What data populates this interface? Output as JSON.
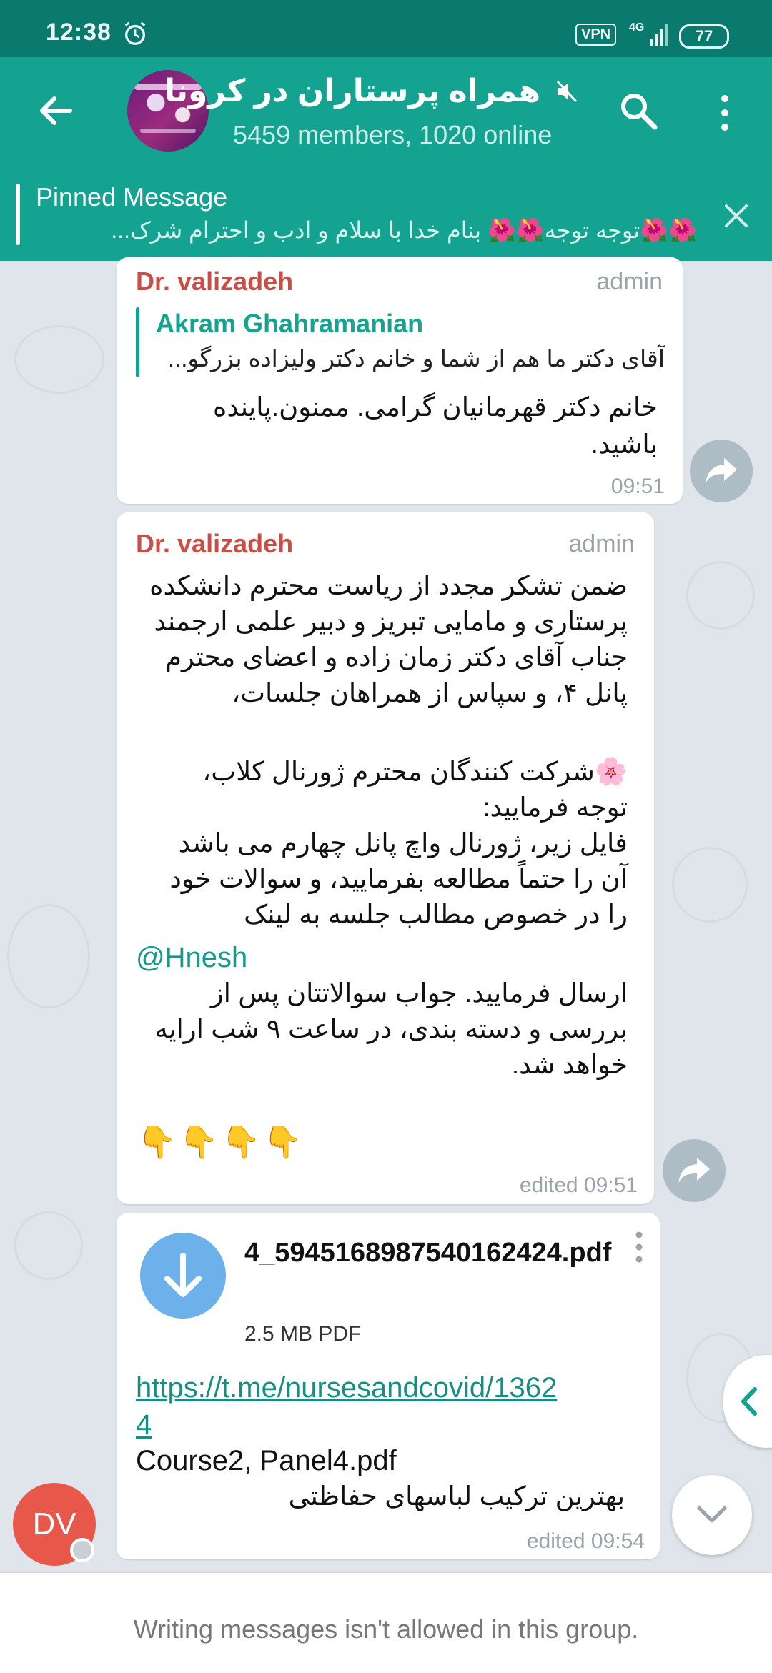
{
  "status_bar": {
    "time": "12:38",
    "vpn": "VPN",
    "network": "4G",
    "battery": "77"
  },
  "header": {
    "title": "همراه پرستاران در کرونا",
    "subtitle": "5459 members, 1020 online",
    "icons": [
      "back-arrow-icon",
      "mute-icon",
      "search-icon",
      "more-vertical-icon"
    ]
  },
  "pinned": {
    "title": "Pinned Message",
    "text": "🌺🌺توجه توجه🌺🌺  بنام خدا  با سلام و ادب و احترام  شرک..."
  },
  "messages": [
    {
      "sender": "Dr. valizadeh",
      "role": "admin",
      "reply_name": "Akram Ghahramanian",
      "reply_text": "آقای دکتر ما هم از شما و خانم دکتر ولیزاده بزرگو...",
      "lines": [
        "خانم دکتر قهرمانیان گرامی. ممنون.پاینده",
        "باشید."
      ],
      "time": "09:51"
    },
    {
      "sender": "Dr. valizadeh",
      "role": "admin",
      "lines_1": [
        "ضمن تشکر مجدد از ریاست محترم دانشکده",
        "پرستاری و مامایی تبریز و دبیر علمی ارجمند",
        "جناب آقای دکتر زمان زاده و اعضای محترم",
        "پانل ۴، و سپاس از همراهان جلسات،"
      ],
      "lines_2": [
        "🌸شرکت کنندگان محترم ژورنال کلاب،",
        "توجه فرمایید:",
        "فایل زیر، ژورنال واچ پانل چهارم می باشد",
        "آن را حتماً مطالعه بفرمایید، و سوالات خود",
        "را در خصوص مطالب جلسه به لینک"
      ],
      "mention": "@Hnesh",
      "lines_3": [
        "ارسال فرمایید. جواب سوالاتتان پس از",
        "بررسی و دسته بندی، در ساعت ۹ شب ارایه",
        "خواهد شد."
      ],
      "emoji_row": "👇👇👇👇",
      "time": "edited 09:51"
    },
    {
      "file_name": "4_5945168987540162424.pdf",
      "file_size": "2.5 MB PDF",
      "link": "https://t.me/nursesandcovid/13624",
      "caption_en": "Course2, Panel4.pdf",
      "caption_fa": "بهترین ترکیب لباسهای حفاظتی",
      "time": "edited 09:54"
    }
  ],
  "avatar_initials": "DV",
  "footer": {
    "text": "Writing messages isn't allowed in this group."
  },
  "colors": {
    "header": "#13a390",
    "status_bar": "#0b7a6e",
    "sender": "#c94f46",
    "link": "#158f82",
    "avatar": "#e8584a"
  }
}
